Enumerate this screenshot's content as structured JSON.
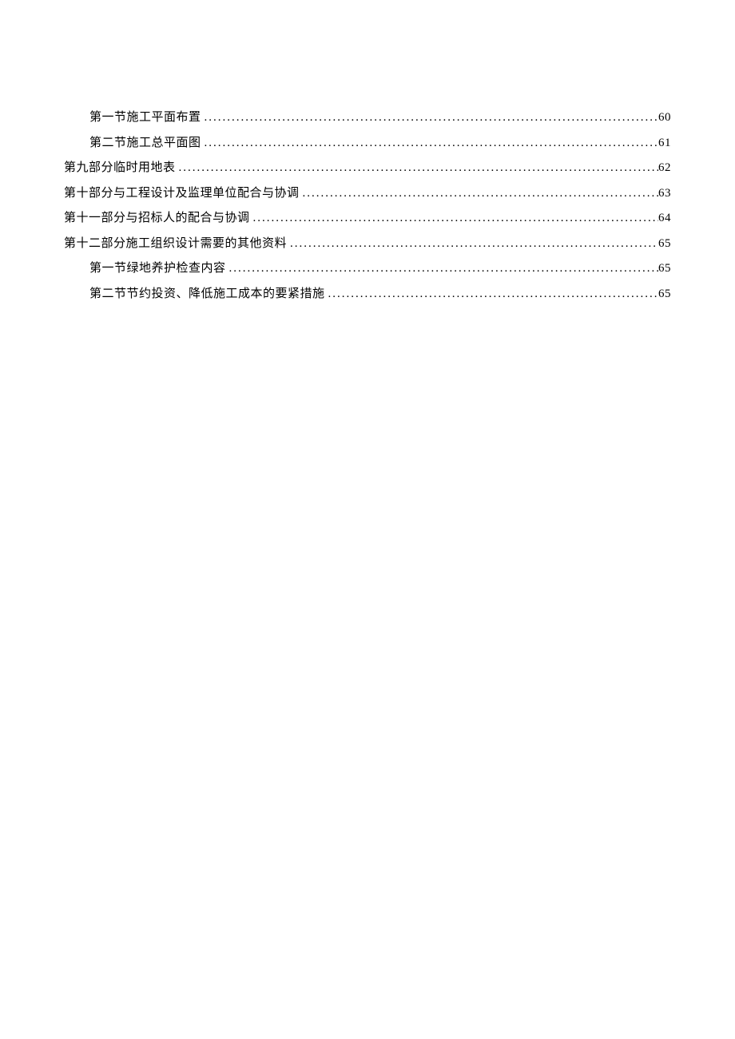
{
  "toc": [
    {
      "title": "第一节施工平面布置",
      "page": "60",
      "indent": 1
    },
    {
      "title": "第二节施工总平面图",
      "page": "61",
      "indent": 1
    },
    {
      "title": "第九部分临时用地表",
      "page": "62",
      "indent": 0
    },
    {
      "title": "第十部分与工程设计及监理单位配合与协调",
      "page": "63",
      "indent": 0
    },
    {
      "title": "第十一部分与招标人的配合与协调",
      "page": "64",
      "indent": 0
    },
    {
      "title": "第十二部分施工组织设计需要的其他资料",
      "page": "65",
      "indent": 0
    },
    {
      "title": "第一节绿地养护检查内容",
      "page": "65",
      "indent": 1
    },
    {
      "title": "第二节节约投资、降低施工成本的要紧措施",
      "page": "65",
      "indent": 1
    }
  ]
}
